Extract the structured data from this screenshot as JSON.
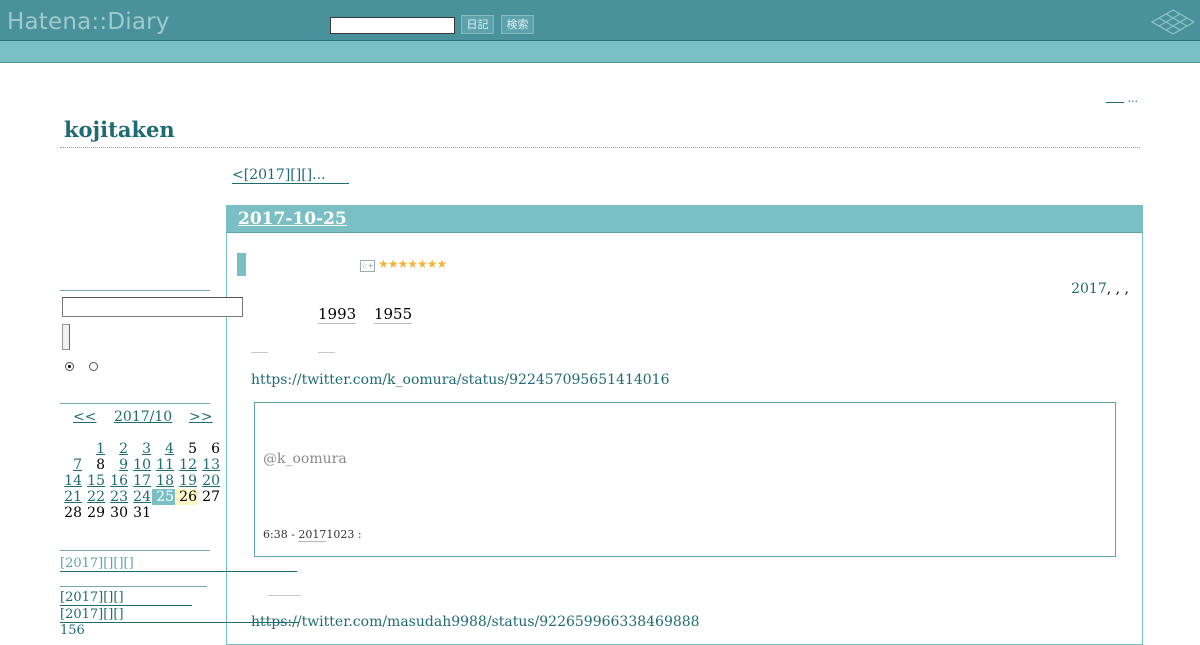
{
  "header": {
    "logo": "Hatena::Diary",
    "search_value": "",
    "diary_button": "日記",
    "search_button": "検索"
  },
  "top_links": "...",
  "blog": {
    "title": "kojitaken",
    "prev_link": "<[2017][][]..."
  },
  "entry": {
    "date": "2017-10-25",
    "stars": "★★★★★★★",
    "categories": "2017",
    "category_suffix": ", , ,",
    "years": [
      "1993",
      "1955"
    ],
    "tweet_link_1": "https://twitter.com/k_oomura/status/922457095651414016",
    "tweet_user": "@k_oomura",
    "tweet_time": "6:38 - ",
    "tweet_date_linked": "2017",
    "tweet_date_rest": "1023 :",
    "tweet_link_2": "https://twitter.com/masudah9988/status/922659966338469888"
  },
  "calendar": {
    "prev": "<<",
    "month": "2017/10",
    "next": ">>",
    "selected_day": "25",
    "today": "26"
  },
  "sidebar": {
    "search_value": "",
    "recent": [
      "[2017][][][]",
      "[2017][][]",
      "[2017][][]",
      "156"
    ]
  },
  "colors": {
    "banner": "#4a929b",
    "accent": "#7abfc4",
    "link": "#1f6b73",
    "star": "#f2b53b"
  }
}
